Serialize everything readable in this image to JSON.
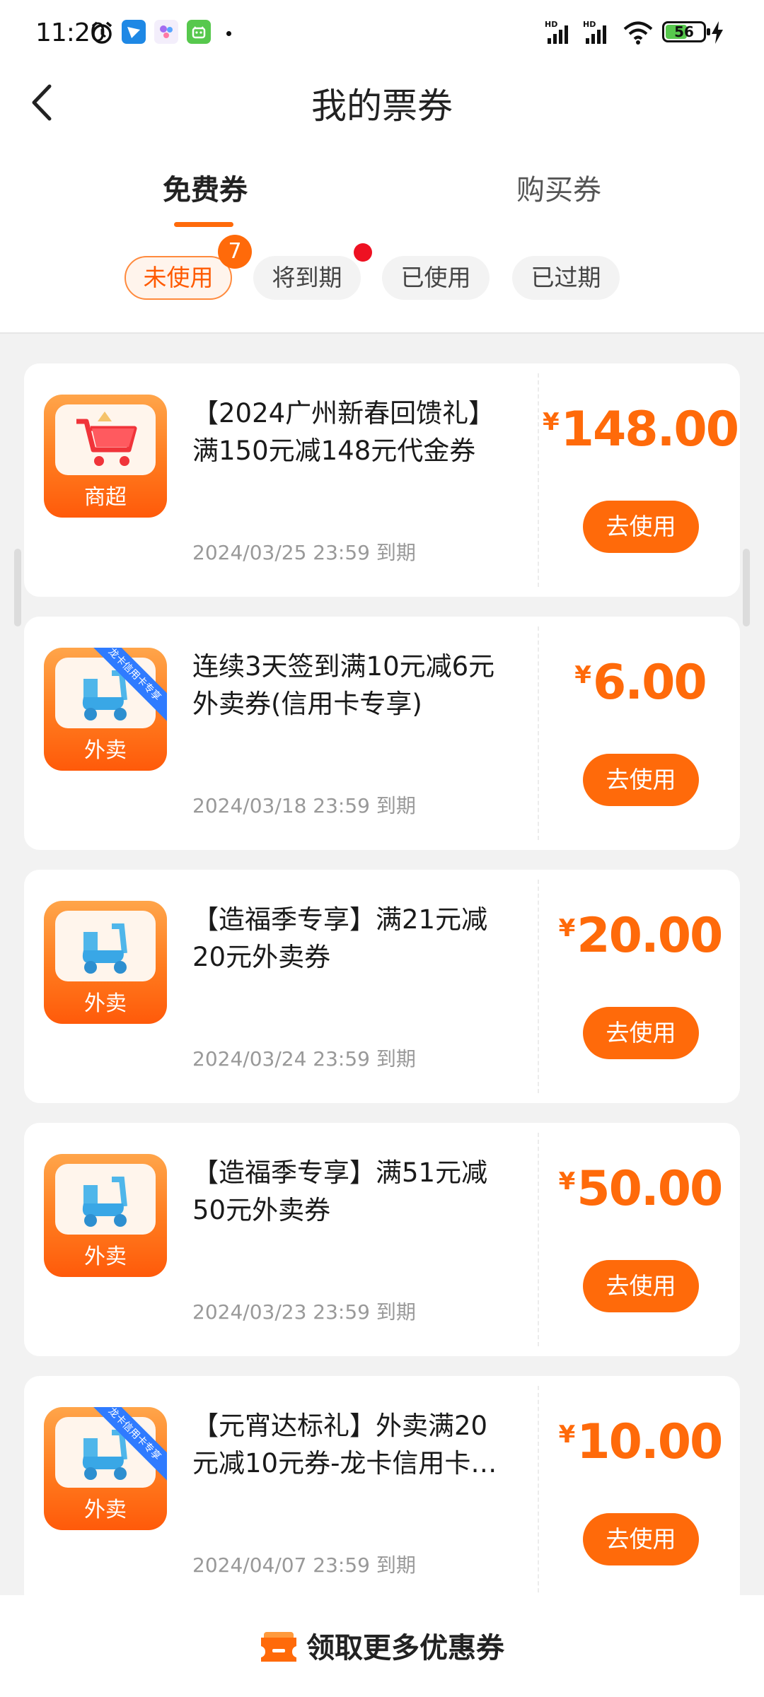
{
  "status_bar": {
    "time": "11:20",
    "battery": "56",
    "network_label": "HD",
    "icons": [
      "alarm-icon",
      "feishu-app-icon",
      "assistant-app-icon",
      "android-app-icon",
      "dot-icon",
      "signal-icon",
      "wifi-icon",
      "battery-icon",
      "charging-icon"
    ]
  },
  "header": {
    "title": "我的票券"
  },
  "tabs": [
    {
      "label": "免费券",
      "active": true
    },
    {
      "label": "购买券",
      "active": false
    }
  ],
  "filters": [
    {
      "label": "未使用",
      "active": true,
      "badge": "7"
    },
    {
      "label": "将到期",
      "active": false,
      "dot": true
    },
    {
      "label": "已使用",
      "active": false
    },
    {
      "label": "已过期",
      "active": false
    }
  ],
  "coupons": [
    {
      "category": "商超",
      "icon": "cart-icon",
      "title_1": "【2024广州新春回馈礼】",
      "title_2": "满150元减148元代金券",
      "currency": "¥",
      "amount": "148.00",
      "expiry": "2024/03/25 23:59 到期",
      "button": "去使用"
    },
    {
      "category": "外卖",
      "icon": "scooter-icon",
      "ribbon": "龙卡信用卡专享",
      "title_1": "连续3天签到满10元减6元",
      "title_2": "外卖券(信用卡专享)",
      "currency": "¥",
      "amount": "6.00",
      "expiry": "2024/03/18 23:59 到期",
      "button": "去使用"
    },
    {
      "category": "外卖",
      "icon": "scooter-icon",
      "title_1": "【造福季专享】满21元减",
      "title_2": "20元外卖券",
      "currency": "¥",
      "amount": "20.00",
      "expiry": "2024/03/24 23:59 到期",
      "button": "去使用"
    },
    {
      "category": "外卖",
      "icon": "scooter-icon",
      "title_1": "【造福季专享】满51元减",
      "title_2": "50元外卖券",
      "currency": "¥",
      "amount": "50.00",
      "expiry": "2024/03/23 23:59 到期",
      "button": "去使用"
    },
    {
      "category": "外卖",
      "icon": "scooter-icon",
      "ribbon": "龙卡信用卡专享",
      "title_1": "【元宵达标礼】外卖满20",
      "title_2": "元减10元券-龙卡信用卡…",
      "currency": "¥",
      "amount": "10.00",
      "expiry": "2024/04/07 23:59 到期",
      "button": "去使用"
    }
  ],
  "bottom": {
    "label": "领取更多优惠券",
    "icon": "ticket-icon"
  },
  "colors": {
    "accent": "#ff6a0a",
    "badge_red": "#ee1122",
    "page_bg": "#f2f2f2"
  }
}
